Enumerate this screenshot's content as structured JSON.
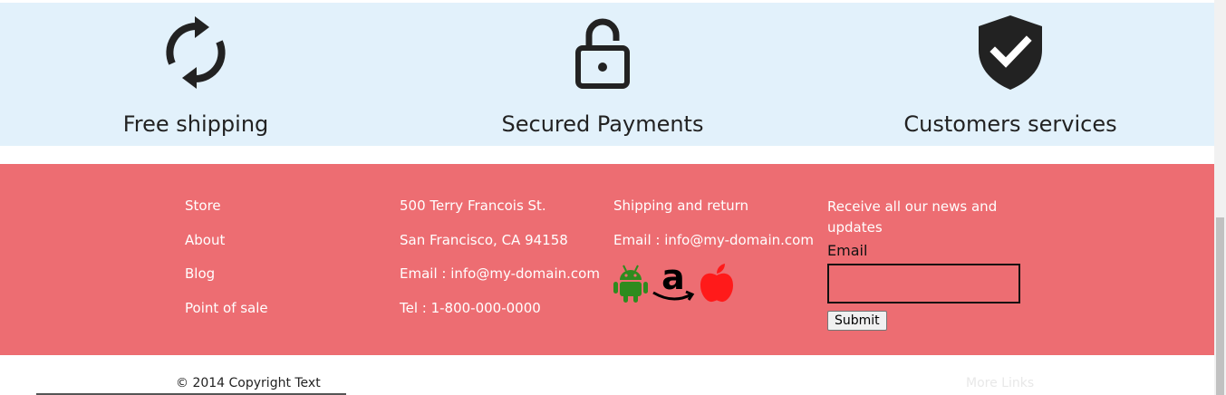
{
  "features": [
    {
      "icon": "refresh-icon",
      "label": "Free shipping"
    },
    {
      "icon": "lock-open-icon",
      "label": "Secured Payments"
    },
    {
      "icon": "shield-check-icon",
      "label": "Customers services"
    }
  ],
  "footer": {
    "links": [
      "Store",
      "About",
      "Blog",
      "Point of sale"
    ],
    "contact": [
      "500 Terry Francois St.",
      "San Francisco, CA 94158",
      "Email : info@my-domain.com",
      "Tel : 1-800-000-0000"
    ],
    "shipping": {
      "title": "Shipping and return",
      "email": "Email : info@my-domain.com",
      "stores": [
        {
          "icon": "android-icon",
          "color": "#2e8b1e"
        },
        {
          "icon": "amazon-icon",
          "color": "#000000"
        },
        {
          "icon": "apple-icon",
          "color": "#ff1a1a"
        }
      ]
    },
    "newsletter": {
      "title": "Receive all our news and updates",
      "email_label": "Email",
      "email_value": "",
      "submit_label": "Submit"
    },
    "background": "#ed6d72"
  },
  "bottom": {
    "copyright": "© 2014 Copyright Text",
    "more_links": "More Links"
  },
  "colors": {
    "features_bg": "#e2f1fb",
    "icon": "#222222"
  }
}
